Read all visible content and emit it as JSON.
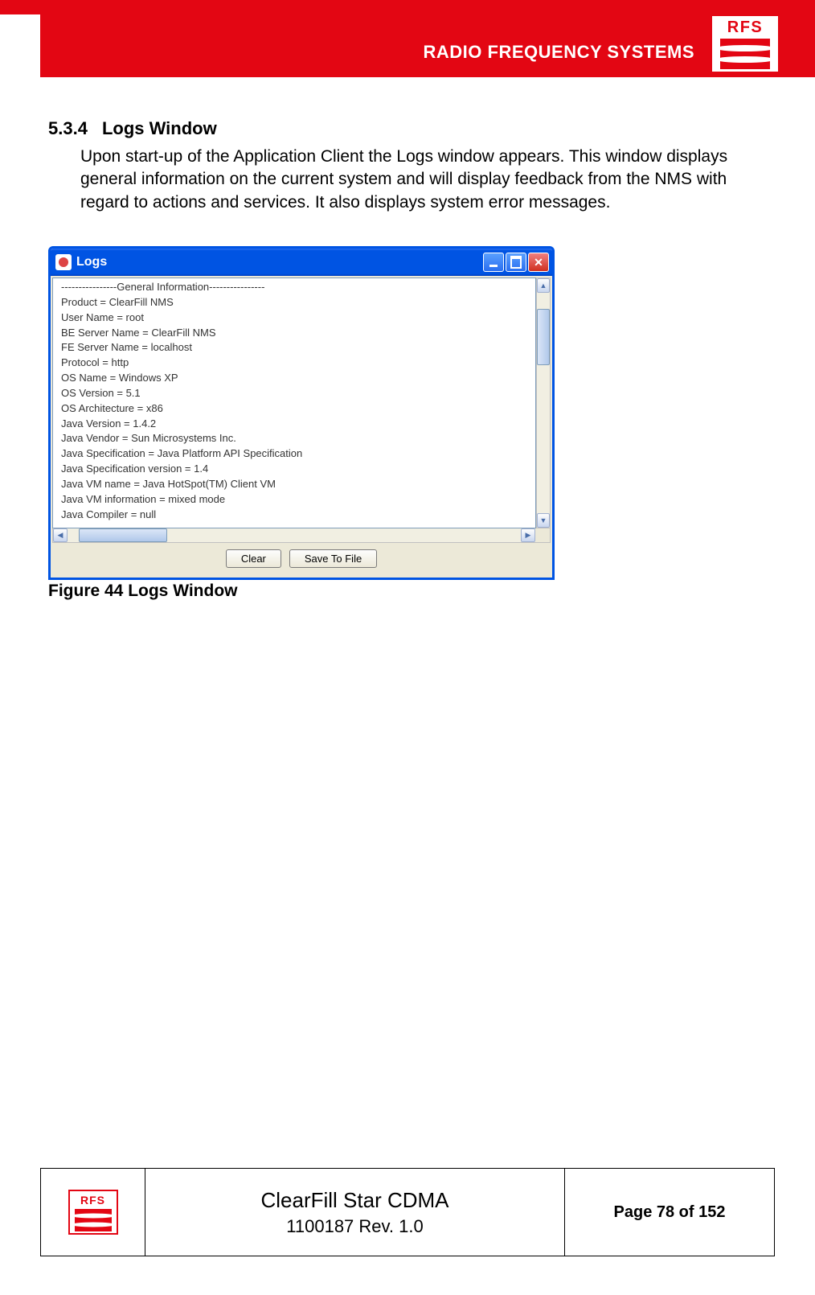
{
  "header": {
    "brand": "RADIO FREQUENCY SYSTEMS",
    "logo_text": "RFS"
  },
  "section": {
    "number": "5.3.4",
    "title": "Logs Window",
    "paragraph": "Upon start-up of the Application Client the Logs window appears. This window displays general information on the current system and will display feedback from the NMS with regard to actions and services. It also displays system error messages."
  },
  "logs_window": {
    "title": "Logs",
    "lines": [
      "----------------General Information----------------",
      " Product = ClearFill NMS",
      " User Name = root",
      " BE Server Name = ClearFill NMS",
      " FE Server Name = localhost",
      " Protocol  = http",
      " OS Name = Windows XP",
      " OS Version = 5.1",
      " OS Architecture = x86",
      " Java Version = 1.4.2",
      " Java Vendor = Sun Microsystems Inc.",
      " Java Specification = Java Platform API Specification",
      " Java Specification version = 1.4",
      " Java VM name = Java HotSpot(TM) Client VM",
      " Java VM information = mixed mode",
      " Java Compiler = null",
      "-----------------------------------------------------"
    ],
    "buttons": {
      "clear": "Clear",
      "save": "Save To File"
    }
  },
  "figure_caption": "Figure 44 Logs Window",
  "footer": {
    "logo_text": "RFS",
    "title_line1": "ClearFill Star CDMA",
    "title_line2": "1100187 Rev. 1.0",
    "page": "Page 78 of 152"
  }
}
